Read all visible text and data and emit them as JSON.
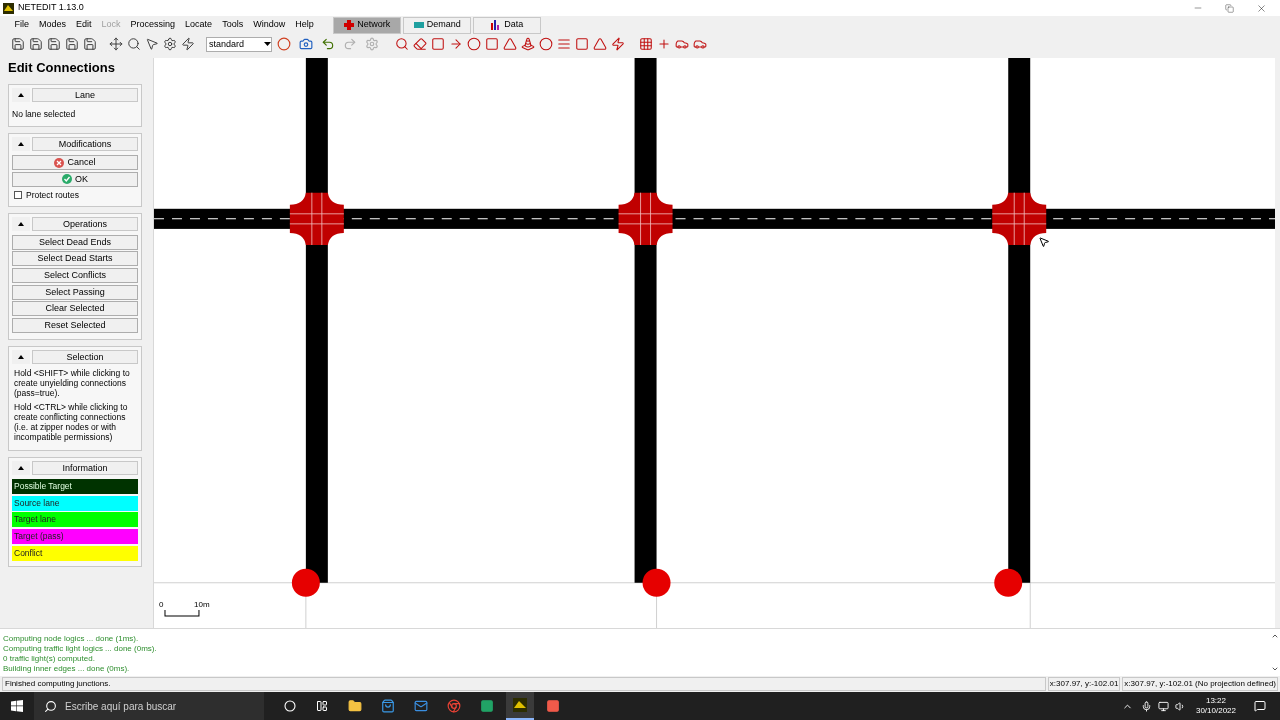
{
  "window": {
    "title": "NETEDIT 1.13.0"
  },
  "menu": [
    {
      "label": "File",
      "disabled": false
    },
    {
      "label": "Modes",
      "disabled": false
    },
    {
      "label": "Edit",
      "disabled": false
    },
    {
      "label": "Lock",
      "disabled": true
    },
    {
      "label": "Processing",
      "disabled": false
    },
    {
      "label": "Locate",
      "disabled": false
    },
    {
      "label": "Tools",
      "disabled": false
    },
    {
      "label": "Window",
      "disabled": false
    },
    {
      "label": "Help",
      "disabled": false
    }
  ],
  "supermodes": [
    {
      "label": "Network",
      "selected": true
    },
    {
      "label": "Demand",
      "selected": false
    },
    {
      "label": "Data",
      "selected": false
    }
  ],
  "toolbar": {
    "scheme": "standard"
  },
  "panel": {
    "title": "Edit Connections",
    "lane": {
      "title": "Lane",
      "text": "No lane selected"
    },
    "modifications": {
      "title": "Modifications",
      "buttons": [
        "Cancel",
        "OK"
      ],
      "protect_routes": {
        "label": "Protect routes",
        "checked": false
      }
    },
    "operations": {
      "title": "Operations",
      "buttons": [
        "Select Dead Ends",
        "Select Dead Starts",
        "Select Conflicts",
        "Select Passing",
        "Clear Selected",
        "Reset Selected"
      ]
    },
    "selection": {
      "title": "Selection",
      "paragraphs": [
        "Hold <SHIFT> while clicking to create unyielding connections (pass=true).",
        "Hold <CTRL> while clicking to create conflicting connections (i.e. at zipper nodes or with incompatible permissions)"
      ]
    },
    "information": {
      "title": "Information",
      "legend": [
        {
          "label": "Possible Target",
          "color": "#003300"
        },
        {
          "label": "Source lane",
          "color": "#00ffff"
        },
        {
          "label": "Target lane",
          "color": "#00ff00"
        },
        {
          "label": "Target (pass)",
          "color": "#ff00ff"
        },
        {
          "label": "Conflict",
          "color": "#ffff00"
        }
      ]
    }
  },
  "canvas": {
    "scale": [
      "0",
      "10m"
    ]
  },
  "log": [
    "Computing node logics ... done (1ms).",
    "Computing traffic light logics ... done (0ms).",
    "0 traffic light(s) computed.",
    "Building inner edges ... done (0ms)."
  ],
  "status_bar": {
    "message": "Finished computing junctions.",
    "coords": [
      "x:307.97, y:-102.01",
      "x:307.97, y:-102.01 (No projection defined)"
    ]
  },
  "taskbar": {
    "search_placeholder": "Escribe aquí para buscar",
    "time": "13:22",
    "date": "30/10/2022"
  }
}
